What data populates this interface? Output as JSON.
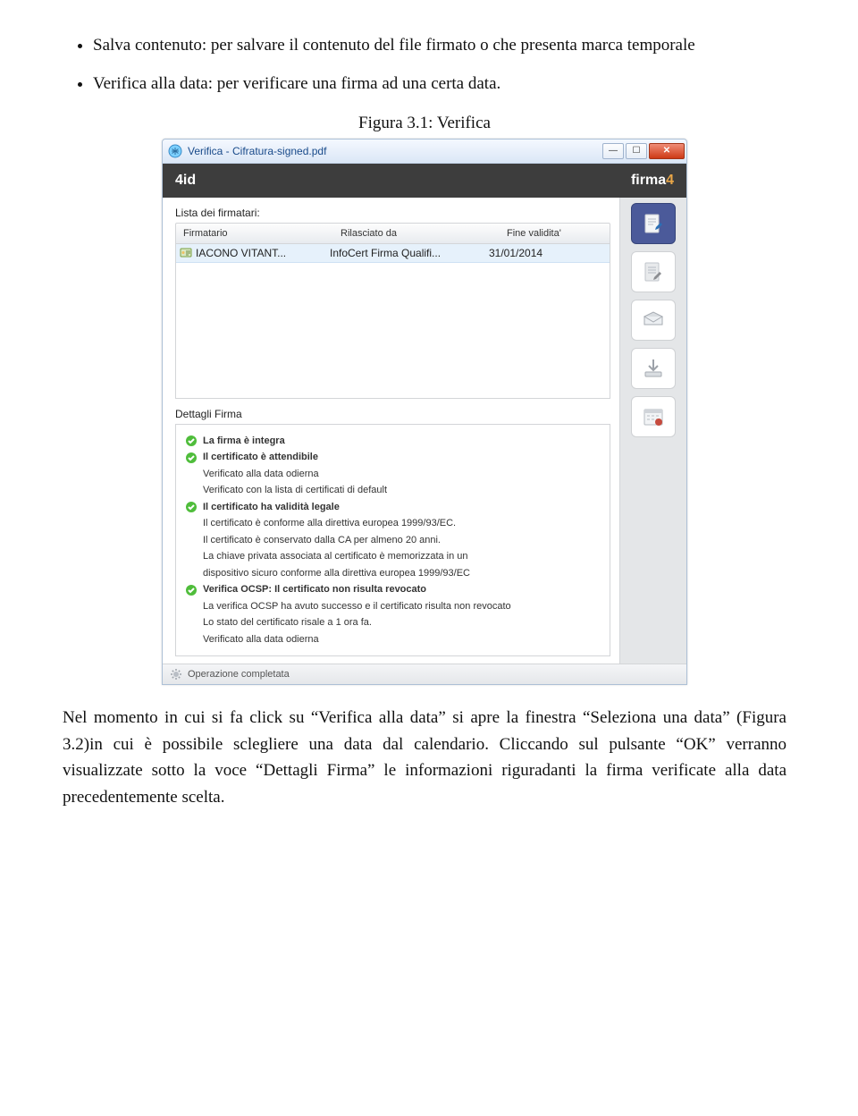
{
  "doc": {
    "bullets": [
      "Salva contenuto: per salvare il contenuto del file firmato o che presenta marca temporale",
      "Verifica alla data: per verificare una firma ad una certa data."
    ],
    "caption": "Figura 3.1: Verifica",
    "bottom_paragraph": "Nel momento in cui si fa click su “Verifica alla data” si apre la finestra “Seleziona una data” (Figura 3.2)in cui è possibile sclegliere una data dal calendario. Cliccando sul pulsante “OK” verranno visualizzate sotto la voce “Dettagli Firma” le informazioni riguradanti la firma verificate alla data precedentemente scelta."
  },
  "window": {
    "title": "Verifica - Cifratura-signed.pdf",
    "controls": {
      "min": "—",
      "max": "☐",
      "close": "✕"
    },
    "brand_left": "4id",
    "brand_right_pre": "firma",
    "brand_right_num": "4",
    "list_label": "Lista dei firmatari:",
    "columns": {
      "c1": "Firmatario",
      "c2": "Rilasciato da",
      "c3": "Fine validita'"
    },
    "row": {
      "name": "IACONO VITANT...",
      "issuer": "InfoCert Firma Qualifi...",
      "expiry": "31/01/2014"
    },
    "details_title": "Dettagli Firma",
    "details": {
      "l1": "La firma è integra",
      "l2": "Il certificato è attendibile",
      "l2a": "Verificato alla data odierna",
      "l2b": "Verificato con la lista di certificati di default",
      "l3": "Il certificato ha validità legale",
      "l3a": "Il certificato è conforme alla direttiva europea 1999/93/EC.",
      "l3b": "Il certificato è conservato dalla CA per almeno 20 anni.",
      "l3c": "La chiave privata associata al certificato è memorizzata in un",
      "l3d": "dispositivo sicuro conforme alla direttiva europea 1999/93/EC",
      "l4": "Verifica OCSP: Il certificato non risulta revocato",
      "l4a": "La verifica OCSP ha avuto successo e il certificato risulta non revocato",
      "l4b": "Lo stato del certificato risale a 1 ora fa.",
      "l4c": "Verificato alla data odierna"
    },
    "status": "Operazione completata",
    "side_icons": [
      "sign-doc-icon",
      "edit-doc-icon",
      "send-mail-icon",
      "save-icon",
      "calendar-icon"
    ]
  }
}
